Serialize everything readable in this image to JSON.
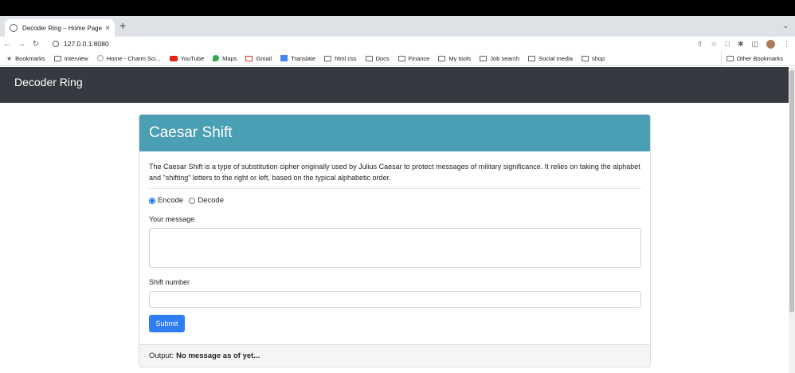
{
  "browser": {
    "tab_title": "Decoder Ring – Home Page",
    "tab_close": "×",
    "new_tab": "+",
    "url": "127.0.0.1:8080",
    "bookmarks": [
      {
        "icon": "star-icon",
        "label": "Bookmarks"
      },
      {
        "icon": "folder-icon",
        "label": "Interview"
      },
      {
        "icon": "site-icon",
        "label": "Home - Charm Sci..."
      },
      {
        "icon": "youtube-icon",
        "label": "YouTube"
      },
      {
        "icon": "maps-icon",
        "label": "Maps"
      },
      {
        "icon": "gmail-icon",
        "label": "Gmail"
      },
      {
        "icon": "translate-icon",
        "label": "Translate"
      },
      {
        "icon": "folder-icon",
        "label": "html css"
      },
      {
        "icon": "folder-icon",
        "label": "Docs"
      },
      {
        "icon": "folder-icon",
        "label": "Finance"
      },
      {
        "icon": "folder-icon",
        "label": "My tools"
      },
      {
        "icon": "folder-icon",
        "label": "Job search"
      },
      {
        "icon": "folder-icon",
        "label": "Social media"
      },
      {
        "icon": "folder-icon",
        "label": "shop"
      }
    ],
    "other_bookmarks": "Other Bookmarks"
  },
  "navbar": {
    "brand": "Decoder Ring",
    "color": "#343a40"
  },
  "card": {
    "title": "Caesar Shift",
    "header_color": "#4b9fb4",
    "description": "The Caesar Shift is a type of substitution cipher originally used by Julius Caesar to protect messages of military significance. It relies on taking the alphabet and \"shifting\" letters to the right or left, based on the typical alphabetic order.",
    "mode": {
      "options": [
        "Encode",
        "Decode"
      ],
      "selected": "Encode"
    },
    "message_label": "Your message",
    "message_value": "",
    "shift_label": "Shift number",
    "shift_value": "",
    "submit_label": "Submit",
    "submit_color": "#2f7ef6",
    "output_label": "Output:",
    "output_value": "No message as of yet..."
  }
}
